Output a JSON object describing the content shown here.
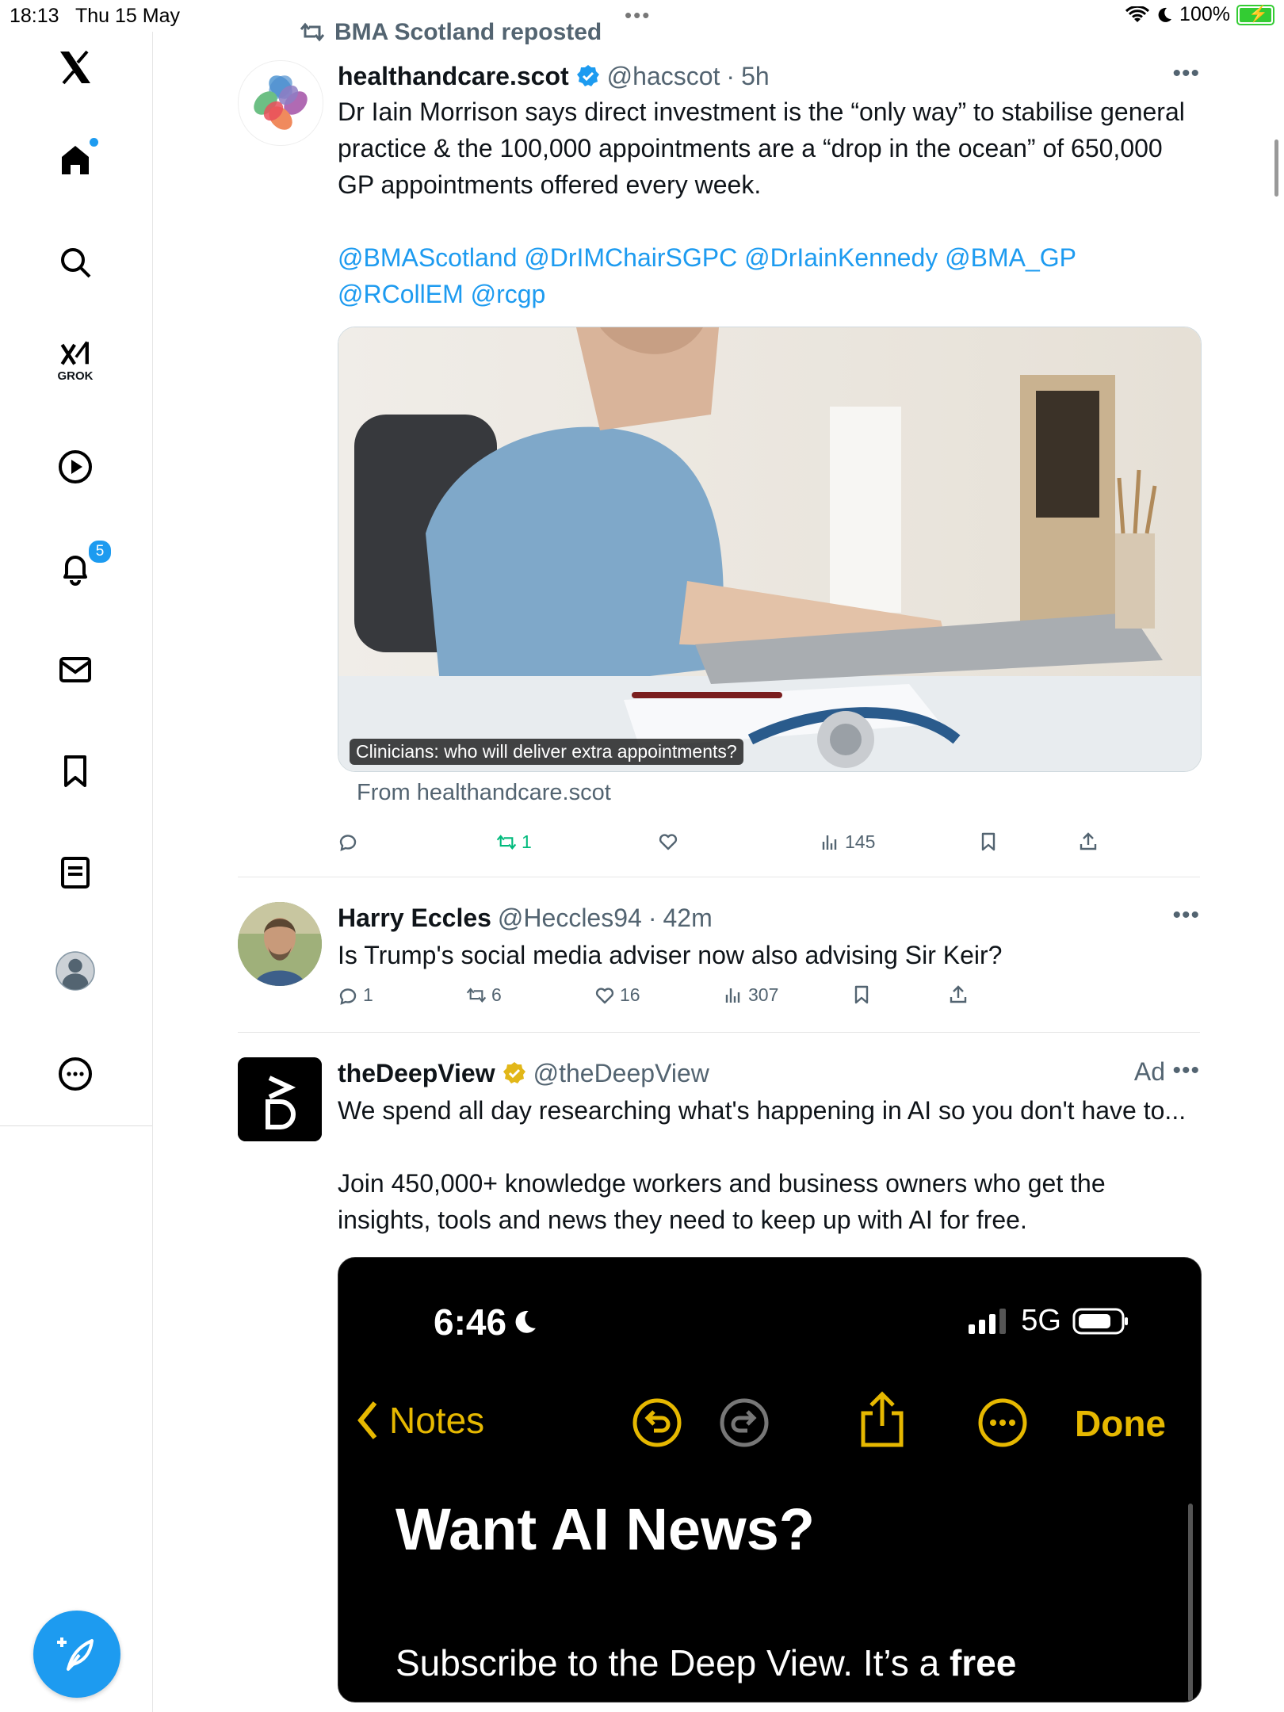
{
  "status_bar": {
    "time": "18:13",
    "date": "Thu 15 May",
    "battery": "100%"
  },
  "sidebar": {
    "items": [
      {
        "name": "x-logo-icon"
      },
      {
        "name": "home-icon"
      },
      {
        "name": "search-icon"
      },
      {
        "name": "grok-icon",
        "label": "GROK"
      },
      {
        "name": "video-icon"
      },
      {
        "name": "notifications-icon",
        "badge": "5"
      },
      {
        "name": "messages-icon"
      },
      {
        "name": "bookmarks-icon"
      },
      {
        "name": "lists-icon"
      },
      {
        "name": "profile-icon"
      },
      {
        "name": "more-icon"
      }
    ],
    "compose": "compose-icon"
  },
  "posts": [
    {
      "repost_by": "BMA Scotland reposted",
      "name": "healthandcare.scot",
      "handle": "@hacscot",
      "time": "5h",
      "verified": "blue",
      "text": "Dr Iain Morrison says direct investment is the “only way” to stabilise general practice & the 100,000 appointments are a “drop in the ocean” of 650,000 GP appointments offered every week.",
      "mentions_line1": "@BMAScotland @DrIMChairSGPC @DrIainKennedy @BMA_GP",
      "mentions_line2": "@RCollEM @rcgp",
      "image_caption": "Clinicians: who will deliver extra appointments?",
      "from": "From healthandcare.scot",
      "stats": {
        "replies": "",
        "reposts": "1",
        "likes": "",
        "views": "145"
      }
    },
    {
      "name": "Harry Eccles",
      "handle": "@Heccles94",
      "time": "42m",
      "text": "Is Trump's social media adviser now also advising Sir Keir?",
      "stats": {
        "replies": "1",
        "reposts": "6",
        "likes": "16",
        "views": "307"
      }
    },
    {
      "name": "theDeepView",
      "handle": "@theDeepView",
      "verified": "gold",
      "ad_label": "Ad",
      "text1": "We spend all day researching what's happening in AI so you don't have to...",
      "text2": "Join 450,000+ knowledge workers and business owners who get the insights, tools and news they need to keep up with AI for free.",
      "media": {
        "time": "6:46",
        "network": "5G",
        "back_label": "Notes",
        "done_label": "Done",
        "headline": "Want AI News?",
        "subline_regular": "Subscribe to the Deep View. It’s a ",
        "subline_bold": "free"
      }
    }
  ]
}
